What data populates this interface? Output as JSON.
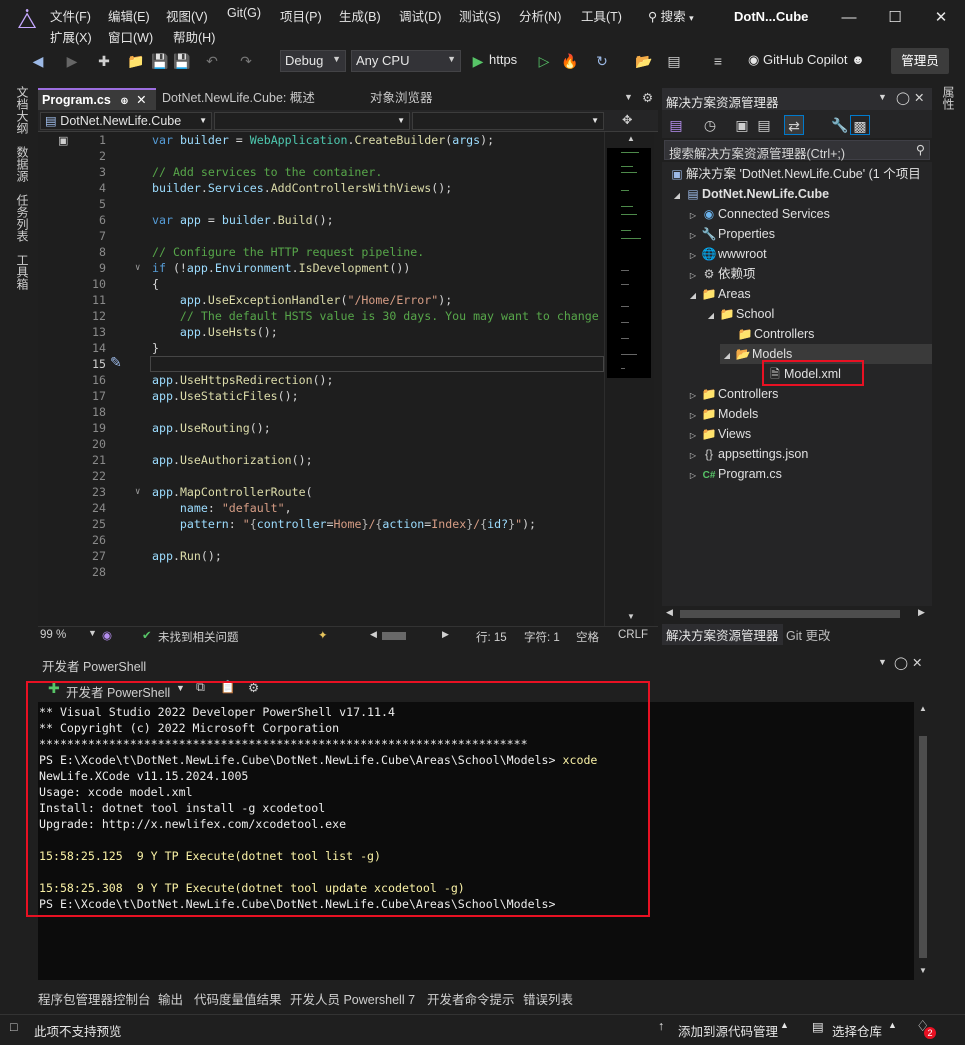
{
  "menu": {
    "row1": [
      "文件(F)",
      "编辑(E)",
      "视图(V)",
      "Git(G)",
      "项目(P)",
      "生成(B)",
      "调试(D)",
      "测试(S)",
      "分析(N)",
      "工具(T)"
    ],
    "row2": [
      "扩展(X)",
      "窗口(W)",
      "帮助(H)"
    ],
    "search_label": "搜索",
    "app_title": "DotN...Cube"
  },
  "toolbar": {
    "config": "Debug",
    "platform": "Any CPU",
    "run_target": "https",
    "copilot_label": "GitHub Copilot",
    "admin_label": "管理员"
  },
  "left_rail": [
    "文档大纲",
    "数据源",
    "任务列表",
    "工具箱"
  ],
  "right_rail": [
    "属性"
  ],
  "editor": {
    "tabs": [
      "Program.cs",
      "DotNet.NewLife.Cube: 概述",
      "对象浏览器"
    ],
    "nav_project": "DotNet.NewLife.Cube",
    "zoom": "99 %",
    "issues": "未找到相关问题",
    "line": "行: 15",
    "col": "字符: 1",
    "whitespace": "空格",
    "eol": "CRLF",
    "line_numbers": [
      "1",
      "2",
      "3",
      "4",
      "5",
      "6",
      "7",
      "8",
      "9",
      "10",
      "11",
      "12",
      "13",
      "14",
      "15",
      "16",
      "17",
      "18",
      "19",
      "20",
      "21",
      "22",
      "23",
      "24",
      "25",
      "26",
      "27",
      "28"
    ]
  },
  "solution_explorer": {
    "title": "解决方案资源管理器",
    "search_placeholder": "搜索解决方案资源管理器(Ctrl+;)",
    "solution_label": "解决方案 'DotNet.NewLife.Cube' (1 个项目",
    "project": "DotNet.NewLife.Cube",
    "nodes": [
      "Connected Services",
      "Properties",
      "wwwroot",
      "依赖项",
      "Areas",
      "School",
      "Controllers",
      "Models",
      "Model.xml",
      "Controllers",
      "Models",
      "Views",
      "appsettings.json",
      "Program.cs"
    ],
    "tabs": [
      "解决方案资源管理器",
      "Git 更改"
    ]
  },
  "powershell": {
    "title": "开发者 PowerShell",
    "new_label": "开发者 PowerShell",
    "lines": [
      "** Visual Studio 2022 Developer PowerShell v17.11.4",
      "** Copyright (c) 2022 Microsoft Corporation",
      "**********************************************************************",
      "PS E:\\Xcode\\t\\DotNet.NewLife.Cube\\DotNet.NewLife.Cube\\Areas\\School\\Models> ",
      "NewLife.XCode v11.15.2024.1005",
      "Usage: xcode model.xml",
      "Install: dotnet tool install -g xcodetool",
      "Upgrade: http://x.newlifex.com/xcodetool.exe",
      "",
      "15:58:25.125  9 Y TP Execute(dotnet tool list -g)",
      "",
      "15:58:25.308  9 Y TP Execute(dotnet tool update xcodetool -g)",
      "PS E:\\Xcode\\t\\DotNet.NewLife.Cube\\DotNet.NewLife.Cube\\Areas\\School\\Models>"
    ],
    "typed_command": "xcode"
  },
  "bottom_tabs": [
    "程序包管理器控制台",
    "输出",
    "代码度量值结果",
    "开发人员 Powershell 7",
    "开发者命令提示",
    "错误列表"
  ],
  "status": {
    "left": "此项不支持预览",
    "add_source": "添加到源代码管理",
    "select_repo": "选择仓库",
    "notifications": "2"
  },
  "colors": {
    "accent": "#9d6ee0",
    "highlight_box": "#e81123"
  }
}
